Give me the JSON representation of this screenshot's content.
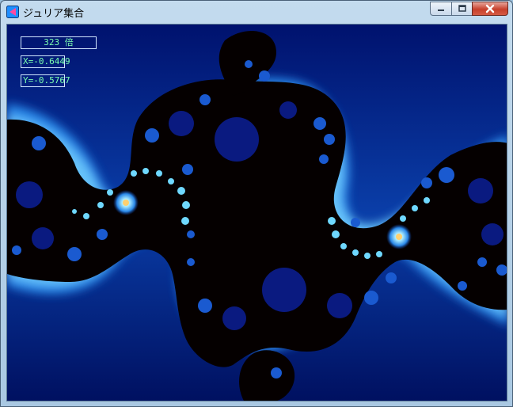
{
  "window": {
    "title": "ジュリア集合",
    "controls": {
      "minimize": "minimize-icon",
      "maximize": "maximize-icon",
      "close": "close-icon"
    }
  },
  "fractal": {
    "zoom": "323 倍",
    "x": "X=-0.6449",
    "y": "Y=-0.5767",
    "colors": {
      "set": "#050000",
      "deep_blue": "#00106a",
      "mid_blue": "#0a50c8",
      "light_blue": "#50b0ff",
      "edge": "#ffe0a0",
      "bulb": "#0a1a80"
    }
  }
}
